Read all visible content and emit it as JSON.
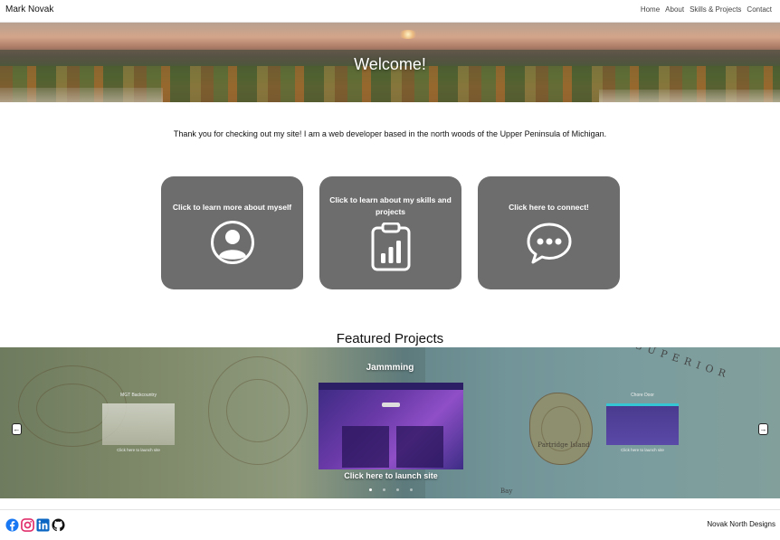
{
  "nav": {
    "brand": "Mark Novak",
    "links": [
      "Home",
      "About",
      "Skills & Projects",
      "Contact"
    ]
  },
  "hero": {
    "title": "Welcome!"
  },
  "intro": "Thank you for checking out my site! I am a web developer based in the north woods of the Upper Peninsula of Michigan.",
  "cards": [
    {
      "label": "Click to learn more about myself",
      "icon": "person-icon"
    },
    {
      "label": "Click to learn about my skills and projects",
      "icon": "clipboard-chart-icon"
    },
    {
      "label": "Click here to connect!",
      "icon": "chat-bubble-icon"
    }
  ],
  "featured": {
    "title": "Featured Projects",
    "active_slide": {
      "title": "Jammming",
      "caption": "Click here to launch site"
    },
    "side_slides": [
      {
        "title": "MGT Backcountry",
        "caption": "Click here to launch site"
      },
      {
        "title": "Chore Door",
        "caption": "Click here to launch site"
      }
    ],
    "map_labels": [
      "SUPERIOR",
      "Partridge Island",
      "Bay"
    ],
    "dot_count": 4,
    "active_dot": 0
  },
  "footer": {
    "social": [
      "facebook-icon",
      "instagram-icon",
      "linkedin-icon",
      "github-icon"
    ],
    "credit": "Novak North Designs"
  },
  "colors": {
    "card_bg": "#6d6d6d",
    "facebook": "#1877f2",
    "instagram": "#e1306c",
    "linkedin": "#0a66c2",
    "github": "#111111"
  }
}
